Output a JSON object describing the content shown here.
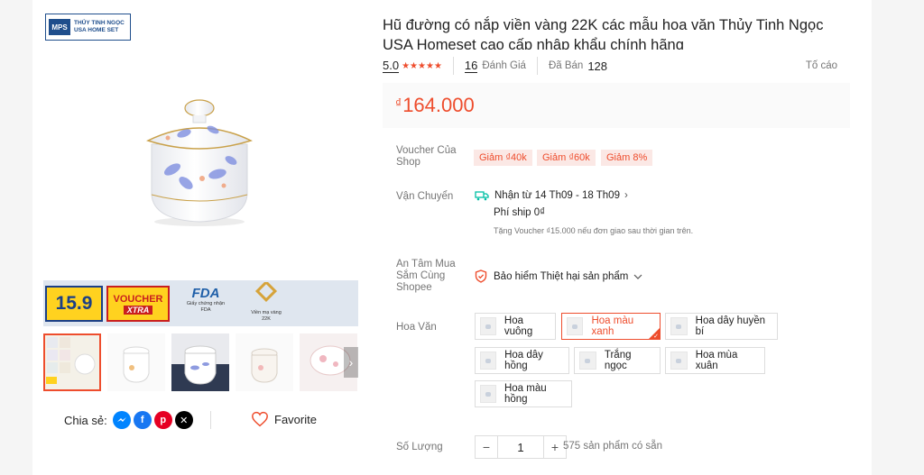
{
  "brand": {
    "line1": "THỦY TINH NGỌC",
    "line2": "USA HOME SET",
    "mark": "MPS"
  },
  "promo": {
    "badge_159": "15.9",
    "voucher_top": "VOUCHER",
    "voucher_bottom": "XTRA",
    "fda_logo": "FDA",
    "fda_caption_1": "Giấy chứng nhận",
    "fda_caption_2": "FDA",
    "gold_caption_1": "Viền mạ vàng",
    "gold_caption_2": "22K"
  },
  "share": {
    "label": "Chia sẻ:",
    "icons": [
      "messenger-icon",
      "facebook-icon",
      "pinterest-icon",
      "x-icon"
    ]
  },
  "favorite": {
    "label": "Favorite"
  },
  "product": {
    "title": "Hũ đường có nắp viền vàng 22K các mẫu hoa văn Thủy Tinh Ngọc USA Homeset cao cấp nhập khẩu chính hãng",
    "rating": "5.0",
    "review_count": "16",
    "review_label": "Đánh Giá",
    "sold_label": "Đã Bán",
    "sold_count": "128",
    "report_label": "Tố cáo",
    "currency": "₫",
    "price": "164.000"
  },
  "voucher": {
    "label_1": "Voucher Của",
    "label_2": "Shop",
    "chips": [
      "Giảm ₫40k",
      "Giảm ₫60k",
      "Giảm 8%"
    ]
  },
  "shipping": {
    "label": "Vận Chuyển",
    "eta": "Nhận từ 14 Th09 - 18 Th09",
    "fee": "Phí ship 0₫",
    "note": "Tặng Voucher ₫15.000 nếu đơn giao sau thời gian trên."
  },
  "insurance": {
    "label_1": "An Tâm Mua",
    "label_2": "Sắm Cùng",
    "label_3": "Shopee",
    "text": "Bảo hiểm Thiệt hại sản phẩm"
  },
  "pattern": {
    "label": "Hoa Văn",
    "options": [
      "Hoa vuông",
      "Hoa màu xanh",
      "Hoa dây huyền bí",
      "Hoa dây hồng",
      "Trắng ngọc",
      "Hoa mùa xuân",
      "Hoa màu hồng"
    ],
    "selected": "Hoa màu xanh"
  },
  "quantity": {
    "label": "Số Lượng",
    "value": "1",
    "minus": "−",
    "plus": "+",
    "stock": "575 sản phẩm có sẵn"
  },
  "colors": {
    "accent": "#ee4d2d",
    "brand_blue": "#1f4e8c"
  }
}
